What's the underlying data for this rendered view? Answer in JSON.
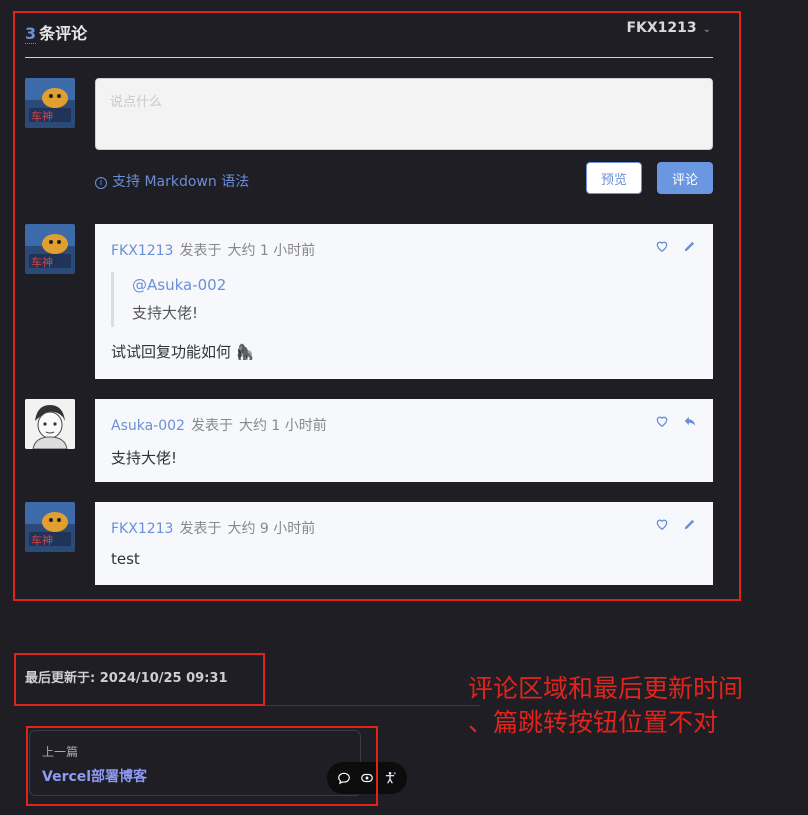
{
  "comments_section": {
    "count": "3",
    "count_label": "条评论",
    "current_user": "FKX1213",
    "editor_placeholder": "说点什么",
    "markdown_hint": "支持 Markdown 语法",
    "preview_button": "预览",
    "submit_button": "评论",
    "comments": [
      {
        "author": "FKX1213",
        "posted_label": "发表于",
        "time": "大约 1 小时前",
        "quote_mention": "@Asuka-002",
        "quote_text": "支持大佬!",
        "body": "试试回复功能如何 🦍",
        "actions": [
          "like-icon",
          "edit-icon"
        ]
      },
      {
        "author": "Asuka-002",
        "posted_label": "发表于",
        "time": "大约 1 小时前",
        "body": "支持大佬!",
        "actions": [
          "like-icon",
          "reply-icon"
        ]
      },
      {
        "author": "FKX1213",
        "posted_label": "发表于",
        "time": "大约 9 小时前",
        "body": "test",
        "actions": [
          "like-icon",
          "edit-icon"
        ]
      }
    ]
  },
  "footer": {
    "last_updated": "最后更新于: 2024/10/25 09:31",
    "prev_label": "上一篇",
    "prev_title": "Vercel部署博客"
  },
  "annotation": {
    "line1": "评论区域和最后更新时间",
    "line2": "、篇跳转按钮位置不对"
  },
  "colors": {
    "accent": "#6b8fd6",
    "annotation_red": "#e0241b",
    "background": "#1e1e24"
  }
}
